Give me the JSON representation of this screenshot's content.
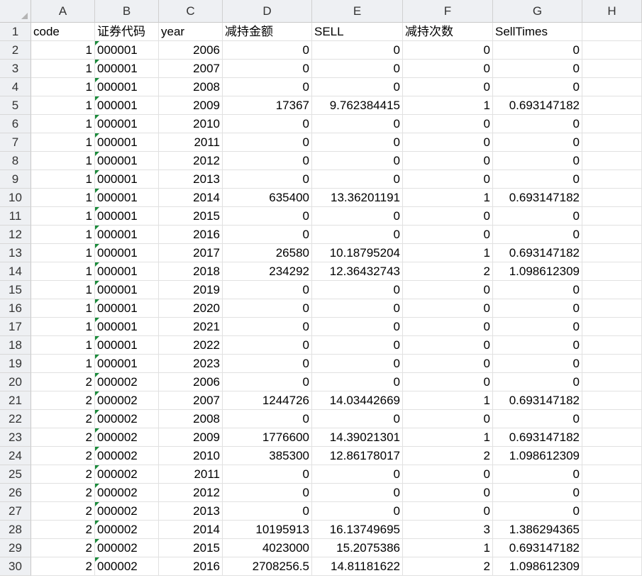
{
  "columns": [
    "A",
    "B",
    "C",
    "D",
    "E",
    "F",
    "G",
    "H"
  ],
  "header_row": [
    "code",
    "证券代码",
    "year",
    "减持金额",
    "SELL",
    "减持次数",
    "SellTimes",
    ""
  ],
  "rows": [
    [
      "1",
      "000001",
      "2006",
      "0",
      "0",
      "0",
      "0"
    ],
    [
      "1",
      "000001",
      "2007",
      "0",
      "0",
      "0",
      "0"
    ],
    [
      "1",
      "000001",
      "2008",
      "0",
      "0",
      "0",
      "0"
    ],
    [
      "1",
      "000001",
      "2009",
      "17367",
      "9.762384415",
      "1",
      "0.693147182"
    ],
    [
      "1",
      "000001",
      "2010",
      "0",
      "0",
      "0",
      "0"
    ],
    [
      "1",
      "000001",
      "2011",
      "0",
      "0",
      "0",
      "0"
    ],
    [
      "1",
      "000001",
      "2012",
      "0",
      "0",
      "0",
      "0"
    ],
    [
      "1",
      "000001",
      "2013",
      "0",
      "0",
      "0",
      "0"
    ],
    [
      "1",
      "000001",
      "2014",
      "635400",
      "13.36201191",
      "1",
      "0.693147182"
    ],
    [
      "1",
      "000001",
      "2015",
      "0",
      "0",
      "0",
      "0"
    ],
    [
      "1",
      "000001",
      "2016",
      "0",
      "0",
      "0",
      "0"
    ],
    [
      "1",
      "000001",
      "2017",
      "26580",
      "10.18795204",
      "1",
      "0.693147182"
    ],
    [
      "1",
      "000001",
      "2018",
      "234292",
      "12.36432743",
      "2",
      "1.098612309"
    ],
    [
      "1",
      "000001",
      "2019",
      "0",
      "0",
      "0",
      "0"
    ],
    [
      "1",
      "000001",
      "2020",
      "0",
      "0",
      "0",
      "0"
    ],
    [
      "1",
      "000001",
      "2021",
      "0",
      "0",
      "0",
      "0"
    ],
    [
      "1",
      "000001",
      "2022",
      "0",
      "0",
      "0",
      "0"
    ],
    [
      "1",
      "000001",
      "2023",
      "0",
      "0",
      "0",
      "0"
    ],
    [
      "2",
      "000002",
      "2006",
      "0",
      "0",
      "0",
      "0"
    ],
    [
      "2",
      "000002",
      "2007",
      "1244726",
      "14.03442669",
      "1",
      "0.693147182"
    ],
    [
      "2",
      "000002",
      "2008",
      "0",
      "0",
      "0",
      "0"
    ],
    [
      "2",
      "000002",
      "2009",
      "1776600",
      "14.39021301",
      "1",
      "0.693147182"
    ],
    [
      "2",
      "000002",
      "2010",
      "385300",
      "12.86178017",
      "2",
      "1.098612309"
    ],
    [
      "2",
      "000002",
      "2011",
      "0",
      "0",
      "0",
      "0"
    ],
    [
      "2",
      "000002",
      "2012",
      "0",
      "0",
      "0",
      "0"
    ],
    [
      "2",
      "000002",
      "2013",
      "0",
      "0",
      "0",
      "0"
    ],
    [
      "2",
      "000002",
      "2014",
      "10195913",
      "16.13749695",
      "3",
      "1.386294365"
    ],
    [
      "2",
      "000002",
      "2015",
      "4023000",
      "15.2075386",
      "1",
      "0.693147182"
    ],
    [
      "2",
      "000002",
      "2016",
      "2708256.5",
      "14.81181622",
      "2",
      "1.098612309"
    ]
  ],
  "colors": {
    "header_bg": "#eef0f3",
    "text_flag": "#1a8a3a",
    "grid": "#e1e1e1"
  }
}
